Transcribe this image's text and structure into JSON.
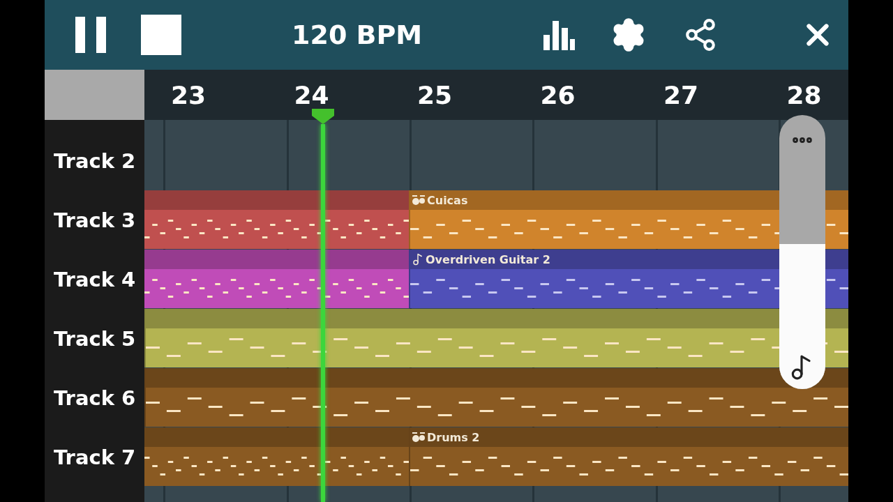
{
  "toolbar": {
    "tempo": "120 BPM"
  },
  "ruler": {
    "bars": [
      "23",
      "24",
      "25",
      "26",
      "27",
      "28"
    ]
  },
  "tracks": [
    {
      "name": "Track 2"
    },
    {
      "name": "Track 3",
      "clips": [
        {
          "color": "#c0504f"
        },
        {
          "label": "Cuicas",
          "kind": "drums",
          "color": "#d0842c"
        }
      ]
    },
    {
      "name": "Track 4",
      "clips": [
        {
          "color": "#c04cb8"
        },
        {
          "label": "Overdriven Guitar 2",
          "kind": "note",
          "color": "#5050b8"
        }
      ]
    },
    {
      "name": "Track 5",
      "clips": [
        {
          "color": "#b4b452"
        }
      ]
    },
    {
      "name": "Track 6",
      "clips": [
        {
          "color": "#8a5a22"
        }
      ]
    },
    {
      "name": "Track 7",
      "clips": [
        {
          "color": "#8a5a22"
        },
        {
          "label": "Drums 2",
          "kind": "drums",
          "color": "#8a5a22"
        }
      ]
    }
  ],
  "volume": {
    "level": 0.53
  }
}
